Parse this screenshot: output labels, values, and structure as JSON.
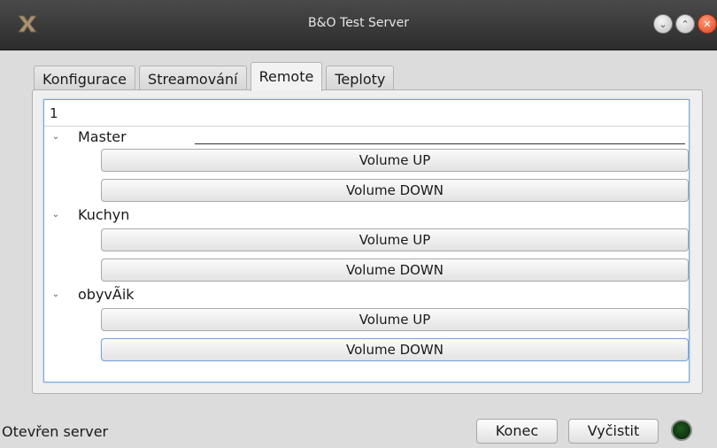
{
  "window": {
    "title": "B&O Test Server",
    "buttons": [
      "minimize",
      "maximize",
      "close"
    ]
  },
  "tabs": [
    {
      "label": "Konfigurace",
      "active": false
    },
    {
      "label": "Streamování",
      "active": false
    },
    {
      "label": "Remote",
      "active": true
    },
    {
      "label": "Teploty",
      "active": false
    }
  ],
  "tree": {
    "header": "1",
    "groups": [
      {
        "name": "Master",
        "buttons": [
          "Volume UP",
          "Volume DOWN"
        ]
      },
      {
        "name": "Kuchyn",
        "buttons": [
          "Volume UP",
          "Volume DOWN"
        ]
      },
      {
        "name": "obyvÃik",
        "buttons": [
          "Volume UP",
          "Volume DOWN"
        ]
      }
    ]
  },
  "statusbar": {
    "text": "Otevřen server",
    "quit_label": "Konec",
    "clear_label": "Vyčistit",
    "led_color": "#0b3a0b"
  },
  "colors": {
    "titlebar": "#333333",
    "focus": "#7aa6d6",
    "close_button": "#e0401a"
  }
}
